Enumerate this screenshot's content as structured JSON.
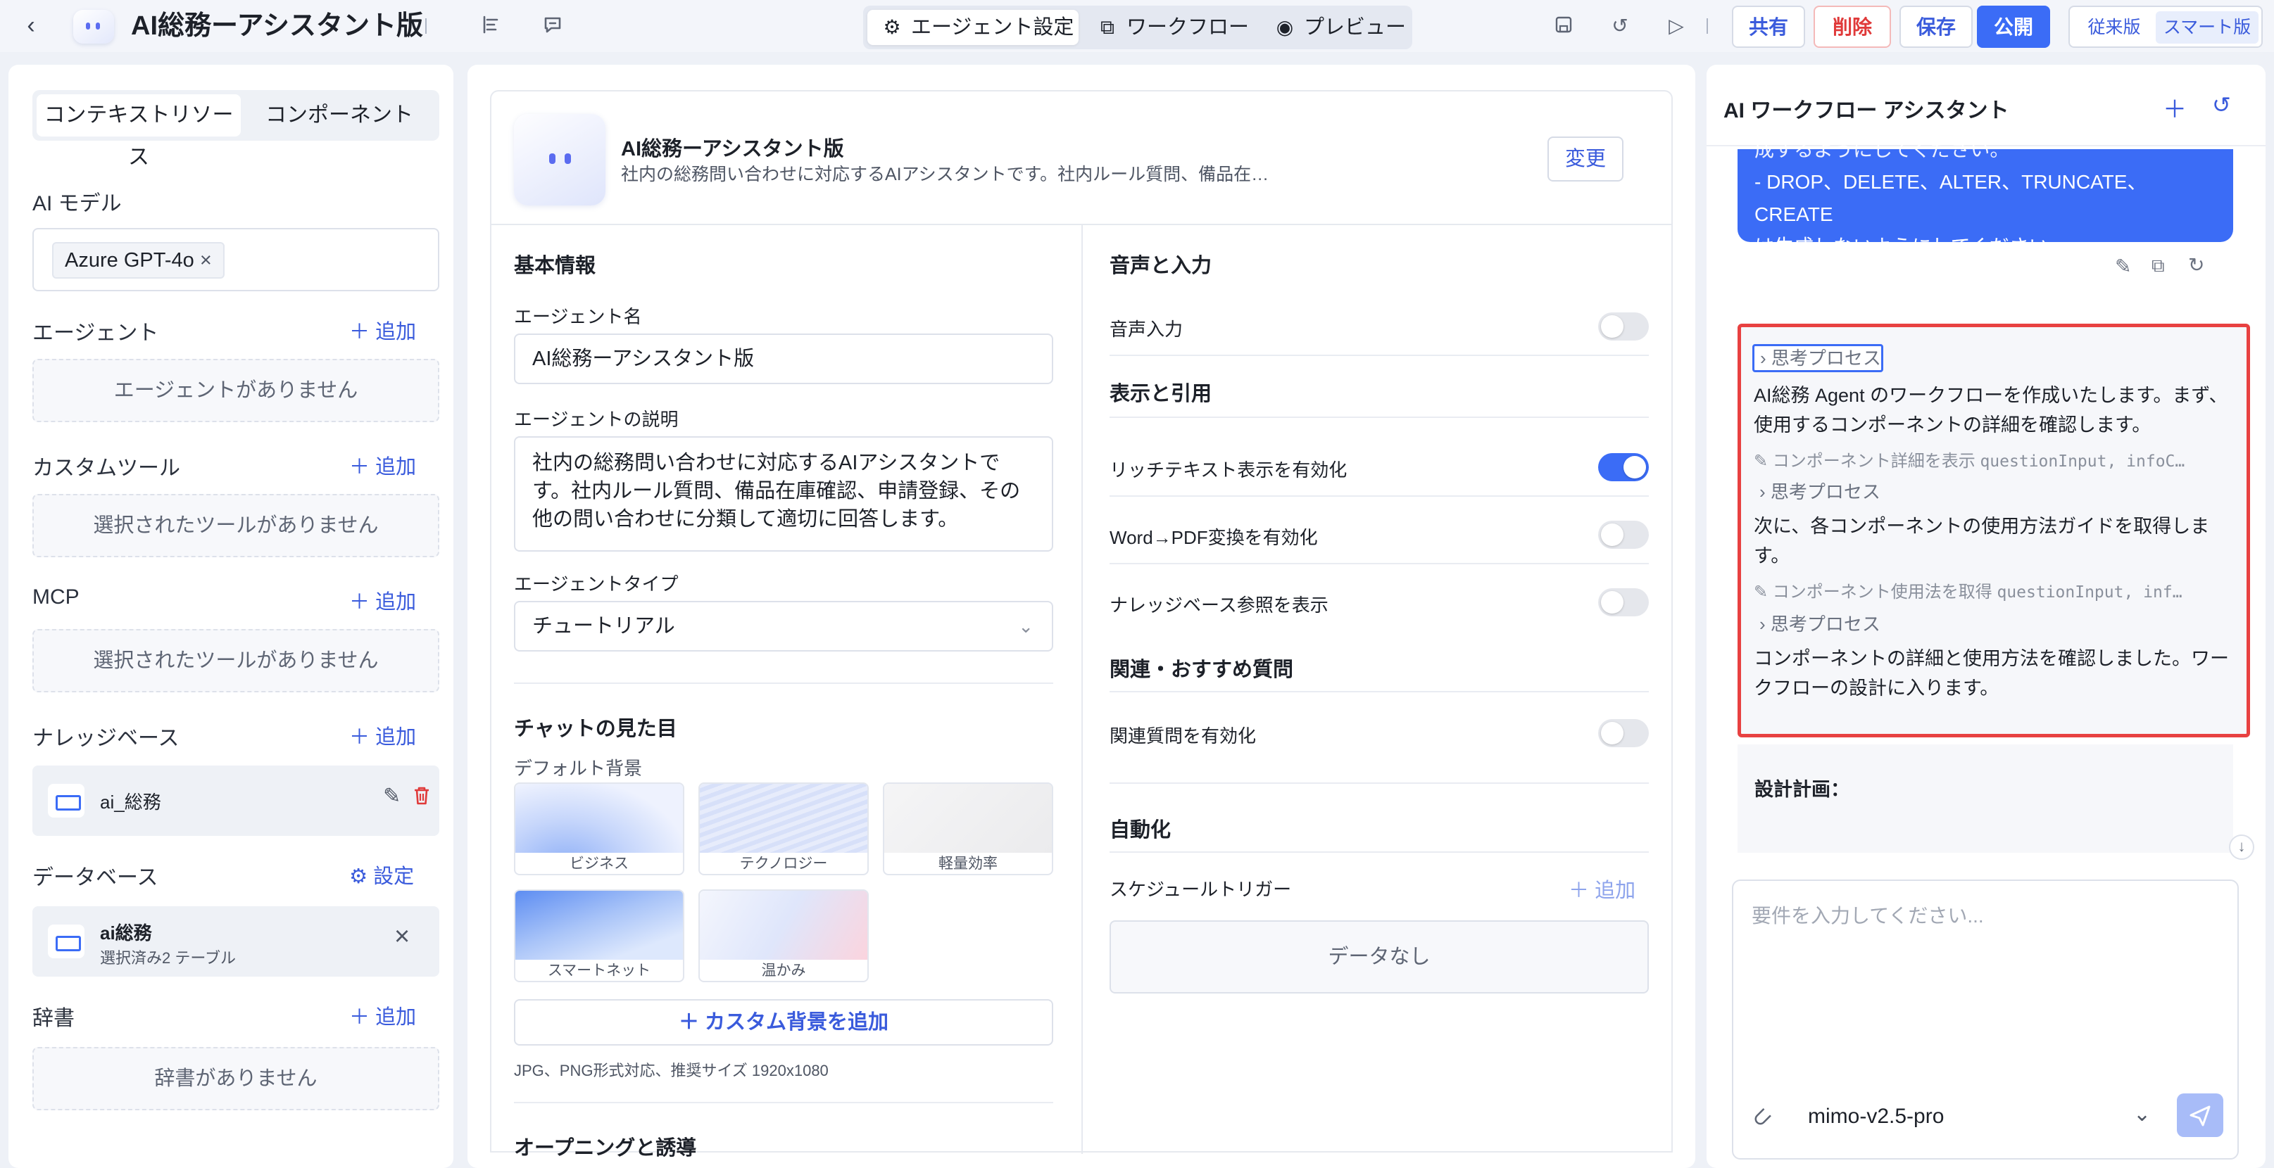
{
  "topbar": {
    "title": "AI総務ーアシスタント版",
    "tabs": [
      {
        "label": "エージェント設定",
        "icon": "gear-icon"
      },
      {
        "label": "ワークフロー",
        "icon": "workflow-icon"
      },
      {
        "label": "プレビュー",
        "icon": "eye-icon"
      }
    ],
    "share_label": "共有",
    "delete_label": "削除",
    "save_label": "保存",
    "publish_label": "公開",
    "mode_classic": "従来版",
    "mode_smart": "スマート版"
  },
  "left": {
    "tab_context": "コンテキストリソース",
    "tab_components": "コンポーネント",
    "ai_model_label": "AI モデル",
    "ai_model_value": "Azure GPT-4o",
    "agent_label": "エージェント",
    "agent_empty": "エージェントがありません",
    "custom_tool_label": "カスタムツール",
    "custom_tool_empty": "選択されたツールがありません",
    "mcp_label": "MCP",
    "mcp_empty": "選択されたツールがありません",
    "kb_label": "ナレッジベース",
    "kb_item": "ai_総務",
    "db_label": "データベース",
    "db_setting": "設定",
    "db_item_name": "ai総務",
    "db_item_sub": "選択済み2 テーブル",
    "dict_label": "辞書",
    "dict_empty": "辞書がありません",
    "add_label": "追加"
  },
  "mid": {
    "agent_name_display": "AI総務ーアシスタント版",
    "agent_desc_short": "社内の総務問い合わせに対応するAIアシスタントです。社内ルール質問、備品在…",
    "change_label": "変更",
    "basic_info": "基本情報",
    "name_label": "エージェント名",
    "name_value": "AI総務ーアシスタント版",
    "desc_label": "エージェントの説明",
    "desc_value": "社内の総務問い合わせに対応するAIアシスタントです。社内ルール質問、備品在庫確認、申請登録、その他の問い合わせに分類して適切に回答します。",
    "type_label": "エージェントタイプ",
    "type_value": "チュートリアル",
    "chat_look": "チャットの見た目",
    "default_bg": "デフォルト背景",
    "bgs": [
      "ビジネス",
      "テクノロジー",
      "軽量効率",
      "スマートネット",
      "温かみ"
    ],
    "add_bg": "カスタム背景を追加",
    "bg_hint": "JPG、PNG形式対応、推奨サイズ 1920x1080",
    "next_section": "オープニングと誘導",
    "voice_input_section": "音声と入力",
    "voice_input": "音声入力",
    "display_section": "表示と引用",
    "rich_text": "リッチテキスト表示を有効化",
    "word_pdf": "Word→PDF変換を有効化",
    "kb_ref": "ナレッジベース参照を表示",
    "related_section": "関連・おすすめ質問",
    "related_enable": "関連質問を有効化",
    "auto_section": "自動化",
    "schedule": "スケジュールトリガー",
    "add_label": "追加",
    "no_data": "データなし",
    "toggles": {
      "voice": false,
      "rich": true,
      "word": false,
      "kb": false,
      "related": false
    }
  },
  "right": {
    "title": "AI ワークフロー アシスタント",
    "bubble_line0": "成するようにしてください。",
    "bubble_line1": "- DROP、DELETE、ALTER、TRUNCATE、CREATE",
    "bubble_line2": "は生成しないようにしてください。",
    "think_label": "思考プロセス",
    "msg1": "AI総務 Agent のワークフローを作成いたします。まず、使用するコンポーネントの詳細を確認します。",
    "tool1_name": "コンポーネント詳細を表示",
    "tool1_args": "questionInput, infoC…",
    "msg2": "次に、各コンポーネントの使用方法ガイドを取得します。",
    "tool2_name": "コンポーネント使用法を取得",
    "tool2_args": "questionInput, inf…",
    "msg3": "コンポーネントの詳細と使用方法を確認しました。ワークフローの設計に入ります。",
    "plan_label": "設計計画：",
    "input_placeholder": "要件を入力してください...",
    "model_name": "mimo-v2.5-pro"
  }
}
